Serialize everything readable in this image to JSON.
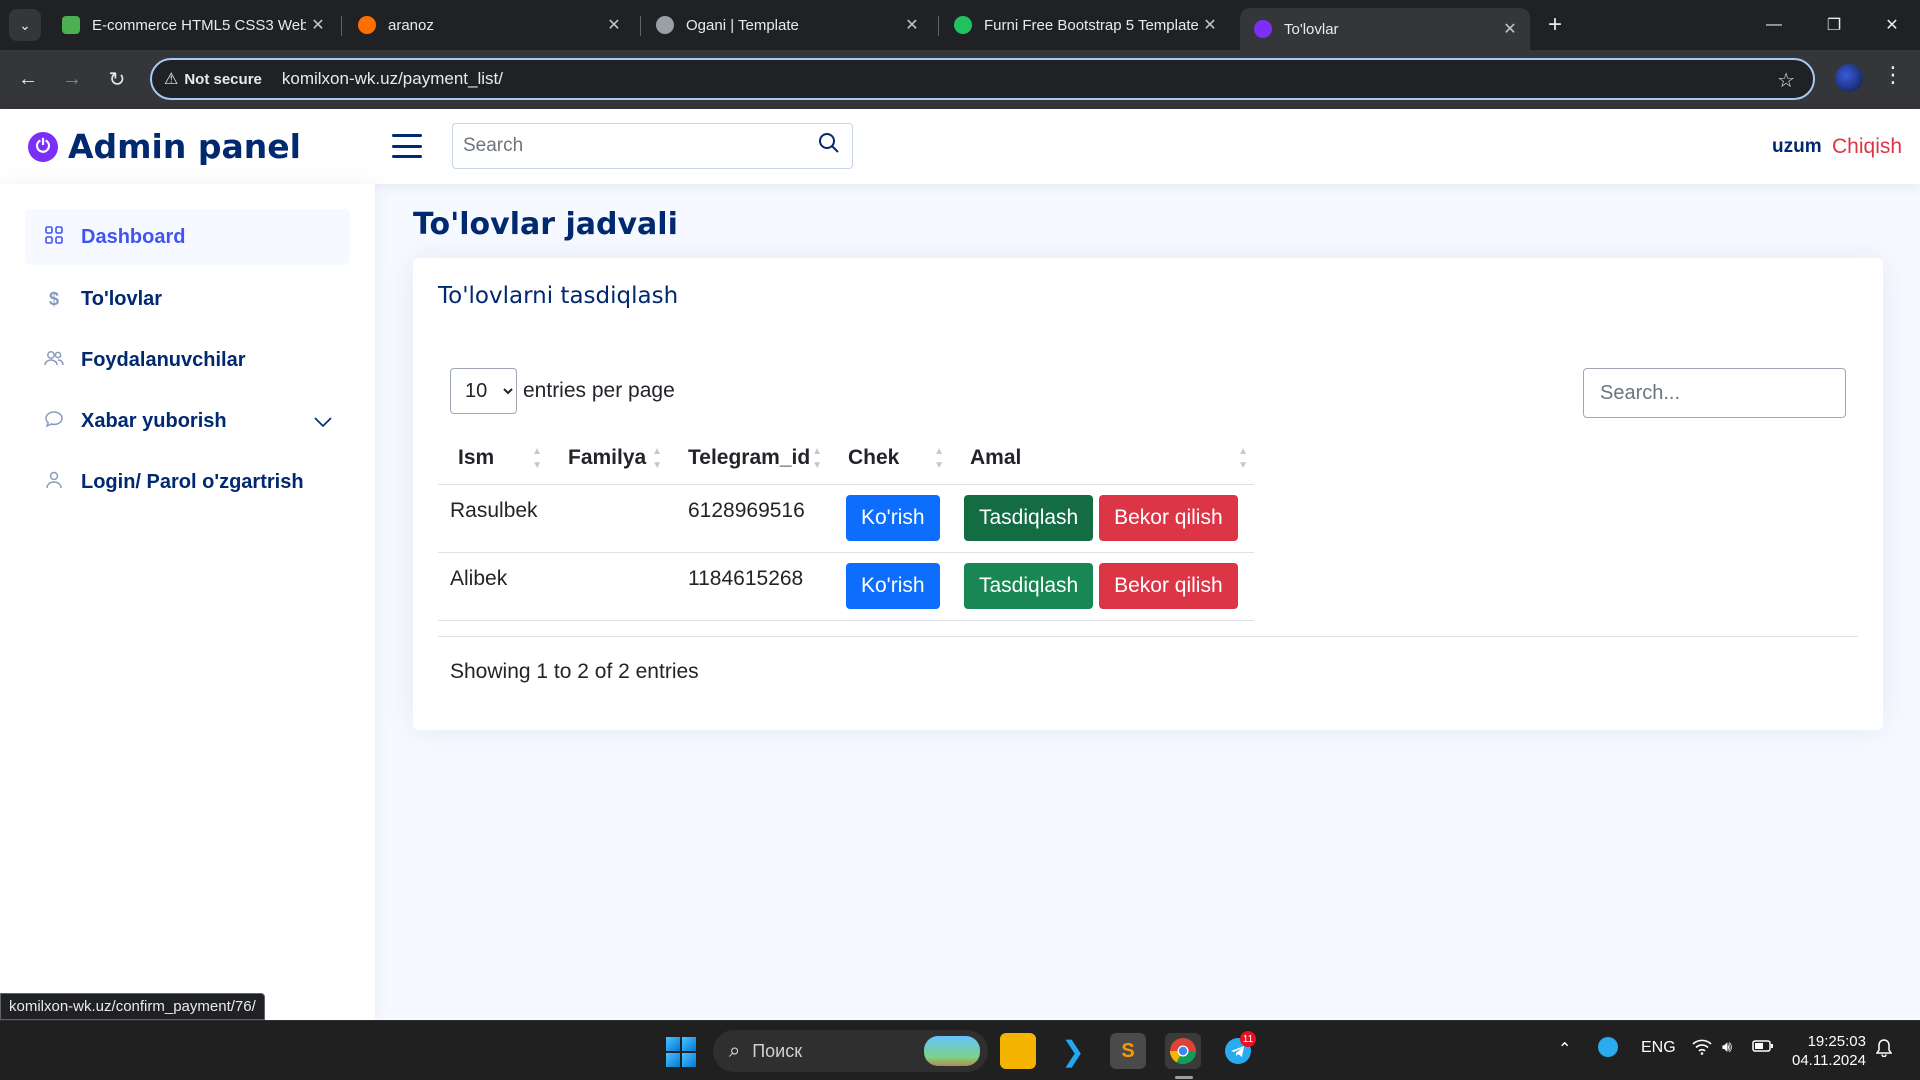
{
  "browser": {
    "tabs": [
      {
        "title": "E-commerce HTML5 CSS3 Web",
        "favicon_color": "#4caf50"
      },
      {
        "title": "aranoz",
        "favicon_color": "#ff6f00"
      },
      {
        "title": "Ogani | Template",
        "favicon_color": "#9aa0a6"
      },
      {
        "title": "Furni Free Bootstrap 5 Template",
        "favicon_color": "#21c25e"
      },
      {
        "title": "To'lovlar",
        "favicon_color": "#7b2ff7"
      }
    ],
    "security_label": "Not secure",
    "url": "komilxon-wk.uz/payment_list/",
    "status_url": "komilxon-wk.uz/confirm_payment/76/"
  },
  "header": {
    "logo_text": "Admin panel",
    "search_placeholder": "Search",
    "username": "uzum",
    "logout_label": "Chiqish"
  },
  "sidebar": {
    "items": [
      {
        "label": "Dashboard",
        "icon": "grid-icon"
      },
      {
        "label": "To'lovlar",
        "icon": "dollar-icon"
      },
      {
        "label": "Foydalanuvchilar",
        "icon": "people-icon"
      },
      {
        "label": "Xabar yuborish",
        "icon": "chat-icon"
      },
      {
        "label": "Login/ Parol o'zgartrish",
        "icon": "person-icon"
      }
    ]
  },
  "main": {
    "page_title": "To'lovlar jadvali",
    "card_title": "To'lovlarni tasdiqlash",
    "per_page_value": "10",
    "per_page_label": "entries per page",
    "search_placeholder": "Search...",
    "columns": [
      "Ism",
      "Familya",
      "Telegram_id",
      "Chek",
      "Amal"
    ],
    "rows": [
      {
        "ism": "Rasulbek",
        "familya": "",
        "telegram_id": "6128969516",
        "chek_label": "Ko'rish",
        "confirm_label": "Tasdiqlash",
        "cancel_label": "Bekor qilish"
      },
      {
        "ism": "Alibek",
        "familya": "",
        "telegram_id": "1184615268",
        "chek_label": "Ko'rish",
        "confirm_label": "Tasdiqlash",
        "cancel_label": "Bekor qilish"
      }
    ],
    "info": "Showing 1 to 2 of 2 entries"
  },
  "taskbar": {
    "search_label": "Поиск",
    "language": "ENG",
    "time": "19:25:03",
    "date": "04.11.2024",
    "telegram_badge": "11"
  }
}
